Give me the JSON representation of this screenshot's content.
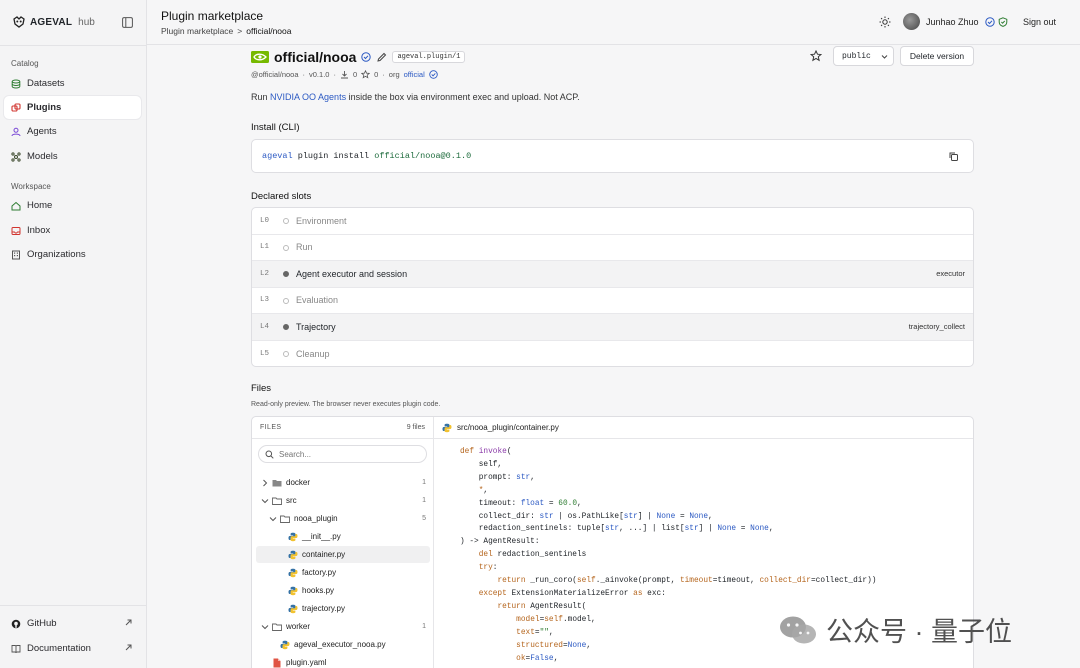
{
  "brand": {
    "name": "AGEVAL",
    "sub": "hub"
  },
  "sidebar": {
    "catalog_label": "Catalog",
    "workspace_label": "Workspace",
    "catalog": [
      {
        "label": "Datasets",
        "icon": "database-icon"
      },
      {
        "label": "Plugins",
        "icon": "plug-icon",
        "active": true
      },
      {
        "label": "Agents",
        "icon": "agents-icon"
      },
      {
        "label": "Models",
        "icon": "models-icon"
      }
    ],
    "workspace": [
      {
        "label": "Home",
        "icon": "home-icon"
      },
      {
        "label": "Inbox",
        "icon": "inbox-icon"
      },
      {
        "label": "Organizations",
        "icon": "building-icon"
      }
    ],
    "footer": [
      {
        "label": "GitHub",
        "icon": "github-icon"
      },
      {
        "label": "Documentation",
        "icon": "book-icon"
      }
    ]
  },
  "header": {
    "title": "Plugin marketplace",
    "breadcrumb": {
      "root": "Plugin marketplace",
      "sep": ">",
      "current": "official/nooa"
    },
    "user": "Junhao Zhuo",
    "signout": "Sign out"
  },
  "plugin": {
    "name": "official/nooa",
    "badge": "ageval.plugin/1",
    "handle": "@official/nooa",
    "version": "v0.1.0",
    "dot": "·",
    "downloads": "0",
    "stars": "0",
    "org_prefix": "org",
    "org": "official",
    "visibility": "public",
    "delete_label": "Delete version",
    "desc_pre": "Run",
    "desc_link": "NVIDIA OO Agents",
    "desc_post": "inside the box via environment exec and upload. Not ACP."
  },
  "install": {
    "heading": "Install (CLI)",
    "cmd": "ageval",
    "sub": "plugin install",
    "ref": "official/nooa@0.1.0"
  },
  "slots": {
    "heading": "Declared slots",
    "rows": [
      {
        "id": "L0",
        "name": "Environment",
        "provides": ""
      },
      {
        "id": "L1",
        "name": "Run",
        "provides": ""
      },
      {
        "id": "L2",
        "name": "Agent executor and session",
        "provides": "executor",
        "filled": true
      },
      {
        "id": "L3",
        "name": "Evaluation",
        "provides": ""
      },
      {
        "id": "L4",
        "name": "Trajectory",
        "provides": "trajectory_collect",
        "filled": true
      },
      {
        "id": "L5",
        "name": "Cleanup",
        "provides": ""
      }
    ]
  },
  "files": {
    "heading": "Files",
    "sub": "Read-only preview. The browser never executes plugin code.",
    "tree_title": "FILES",
    "count": "9 files",
    "search_placeholder": "Search...",
    "open_file": "src/nooa_plugin/container.py",
    "tree": [
      {
        "label": "docker",
        "type": "folder",
        "depth": 0,
        "expanded": false,
        "count": "1"
      },
      {
        "label": "src",
        "type": "folder",
        "depth": 0,
        "expanded": true,
        "count": "1"
      },
      {
        "label": "nooa_plugin",
        "type": "folder",
        "depth": 1,
        "expanded": true,
        "count": "5"
      },
      {
        "label": "__init__.py",
        "type": "py",
        "depth": 2
      },
      {
        "label": "container.py",
        "type": "py",
        "depth": 2,
        "selected": true
      },
      {
        "label": "factory.py",
        "type": "py",
        "depth": 2
      },
      {
        "label": "hooks.py",
        "type": "py",
        "depth": 2
      },
      {
        "label": "trajectory.py",
        "type": "py",
        "depth": 2
      },
      {
        "label": "worker",
        "type": "folder",
        "depth": 0,
        "expanded": true,
        "count": "1"
      },
      {
        "label": "ageval_executor_nooa.py",
        "type": "py",
        "depth": 1
      },
      {
        "label": "plugin.yaml",
        "type": "yaml",
        "depth": 0
      }
    ]
  },
  "watermark": "公众号 · 量子位",
  "colors": {
    "accent": "#2b59c3",
    "nvidia": "#76b900",
    "sidebar_bg": "#f4f4f5"
  }
}
